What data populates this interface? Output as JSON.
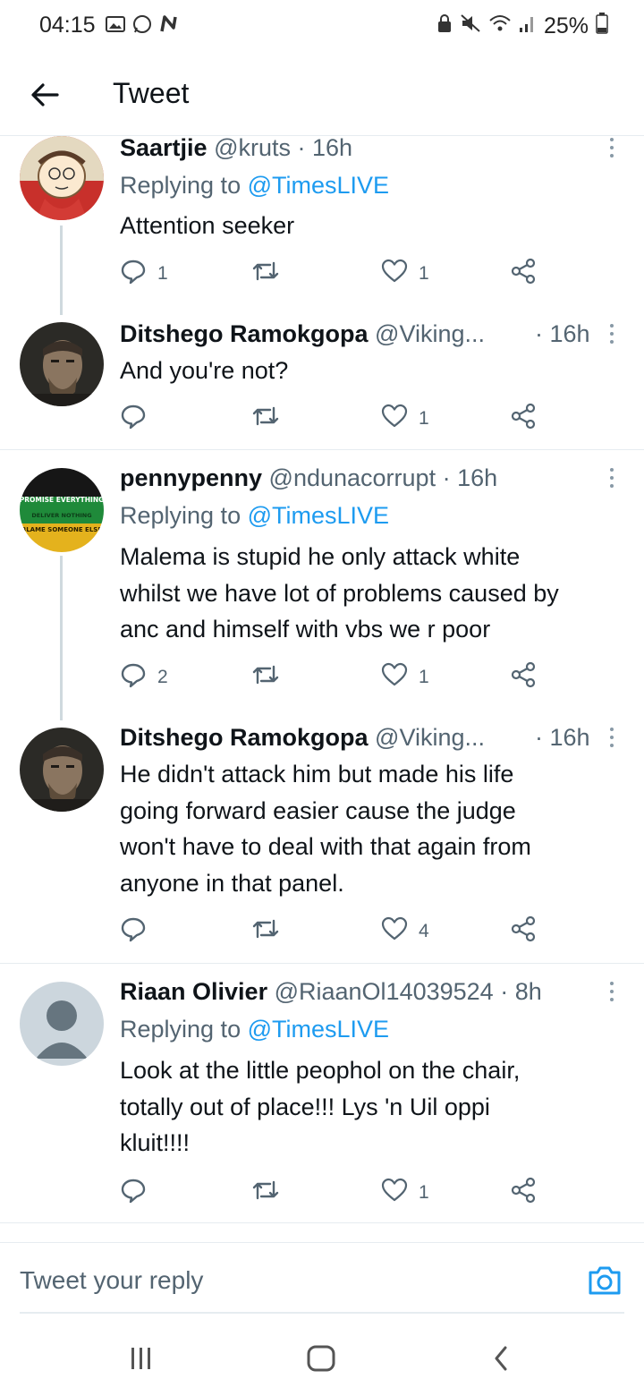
{
  "status_bar": {
    "time": "04:15",
    "battery": "25%",
    "icons": [
      "gallery-icon",
      "whatsapp-icon",
      "n-app-icon",
      "lock-icon",
      "mute-icon",
      "wifi-icon",
      "signal-icon",
      "battery-icon"
    ]
  },
  "header": {
    "title": "Tweet",
    "back_icon": "back-arrow-icon"
  },
  "tweets": [
    {
      "name": "Saartjie",
      "handle": "@kruts",
      "time": "· 16h",
      "replying_prefix": "Replying to",
      "replying_to": "@TimesLIVE",
      "text": "Attention seeker",
      "replies": "1",
      "retweets": "",
      "likes": "1",
      "avatar": "cartoon-avatar"
    },
    {
      "name": "Ditshego Ramokgopa",
      "handle": "@Viking...",
      "time": "· 16h",
      "text": "And you're not?",
      "replies": "",
      "retweets": "",
      "likes": "1",
      "avatar": "viking-avatar"
    },
    {
      "name": "pennypenny",
      "handle": "@ndunacorrupt",
      "time": "· 16h",
      "replying_prefix": "Replying to",
      "replying_to": "@TimesLIVE",
      "text": "Malema is stupid he only attack white\nwhilst we have lot of problems caused by\nanc and himself with vbs we r poor",
      "replies": "2",
      "retweets": "",
      "likes": "1",
      "avatar": "promise-avatar",
      "avatar_text": [
        "PROMISE EVERYTHING",
        "DELIVER NOTHING",
        "BLAME SOMEONE ELSE"
      ]
    },
    {
      "name": "Ditshego Ramokgopa",
      "handle": "@Viking...",
      "time": "· 16h",
      "text": "He didn't attack him but made his life\ngoing forward easier cause the judge\nwon't have to deal with that again from\nanyone in that panel.",
      "replies": "",
      "retweets": "",
      "likes": "4",
      "avatar": "viking-avatar"
    },
    {
      "name": "Riaan Olivier",
      "handle": "@RiaanOl14039524",
      "time": "· 8h",
      "replying_prefix": "Replying to",
      "replying_to": "@TimesLIVE",
      "text": "Look at the little peophol on the chair,\ntotally out of place!!! Lys 'n Uil oppi\nkluit!!!!",
      "replies": "",
      "retweets": "",
      "likes": "1",
      "avatar": "default-avatar"
    }
  ],
  "reply_bar": {
    "placeholder": "Tweet your reply",
    "camera_icon": "camera-icon"
  },
  "navbar": {
    "icons": [
      "recent-apps-icon",
      "home-icon",
      "back-icon"
    ]
  },
  "colors": {
    "link": "#1d9bf0",
    "secondary_text": "#536471",
    "primary_text": "#0f1419",
    "divider": "#e6ecf0"
  }
}
